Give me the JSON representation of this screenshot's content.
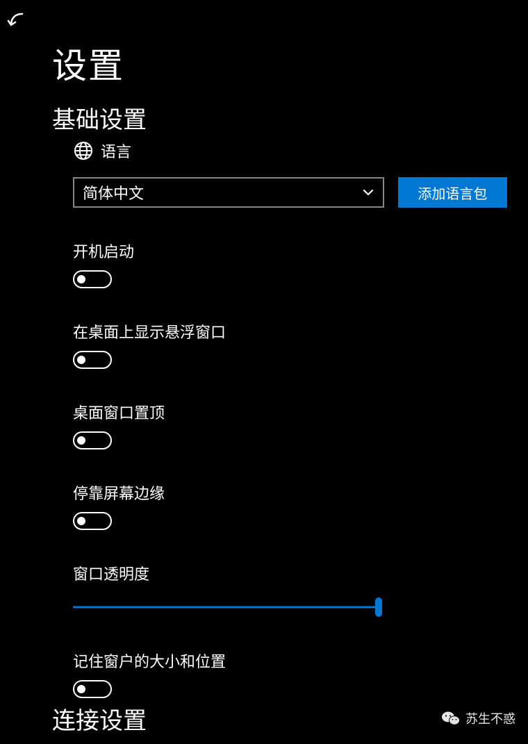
{
  "page_title": "设置",
  "sections": {
    "basic": "基础设置",
    "connection": "连接设置"
  },
  "language": {
    "label": "语言",
    "selected": "简体中文",
    "add_button": "添加语言包"
  },
  "settings": {
    "startup": {
      "label": "开机启动",
      "value": false
    },
    "show_floating": {
      "label": "在桌面上显示悬浮窗口",
      "value": false
    },
    "always_on_top": {
      "label": "桌面窗口置顶",
      "value": false
    },
    "dock_edge": {
      "label": "停靠屏幕边缘",
      "value": false
    },
    "opacity": {
      "label": "窗口透明度",
      "value": 100
    },
    "remember_size_pos": {
      "label": "记住窗户的大小和位置",
      "value": false
    }
  },
  "watermark": "苏生不惑"
}
